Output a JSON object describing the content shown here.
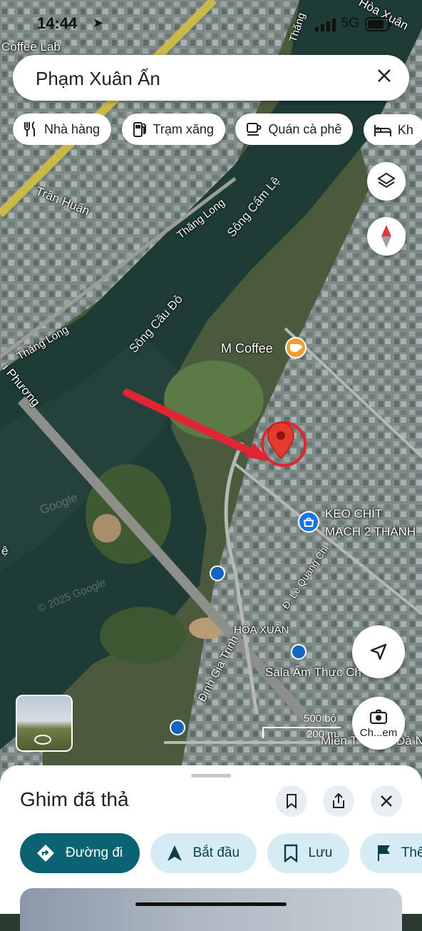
{
  "status": {
    "time": "14:44",
    "network": "5G"
  },
  "search": {
    "query": "Phạm Xuân Ẩn"
  },
  "chips": [
    {
      "label": "Nhà hàng",
      "icon": "fork-knife-icon"
    },
    {
      "label": "Trạm xăng",
      "icon": "gas-station-icon"
    },
    {
      "label": "Quán cà phê",
      "icon": "coffee-cup-icon"
    },
    {
      "label": "Kh",
      "icon": "hotel-bed-icon"
    }
  ],
  "map": {
    "labels": {
      "coffee_lab": "Coffee Lab",
      "tran_huan": "Trần Huấn",
      "thang_long_1": "Thăng Long",
      "thang_long_2": "Thăng Long",
      "thang_long_3": "Thăng Long",
      "song_cam_le": "Sông Cẩm Lệ",
      "song_cau_do": "Sông Cầu Đỏ",
      "m_coffee": "M Coffee",
      "keo_chit": "KEO CHÍT",
      "mach": "MẠCH 2 THÀNH",
      "le_quang_chi": "Đ. Lê Quang Chi",
      "hoa_xuan": "HÒA XUÂN",
      "dinh_gia_trinh": "Đinh Gia Trinh",
      "sala": "Sala Ẩm Thực Ch",
      "phuong": "i Phương",
      "mien": "Miền T",
      "da_n": "Đà N",
      "hoa_xuan_top": "Hòa Xuân",
      "thang_top": "Thăng",
      "le": "ệ",
      "google1": "Google",
      "google2": "© 2025 Google"
    },
    "scale": {
      "top": "500 bộ",
      "bottom": "200 m"
    },
    "camera_label": "Ch...em",
    "accent_color": "#e53935"
  },
  "sheet": {
    "title": "Ghim đã thả",
    "actions": [
      {
        "label": "Đường đi",
        "icon": "directions-icon"
      },
      {
        "label": "Bắt đầu",
        "icon": "navigation-arrow-icon"
      },
      {
        "label": "Lưu",
        "icon": "bookmark-icon"
      },
      {
        "label": "Thêm",
        "icon": "flag-icon"
      }
    ]
  }
}
